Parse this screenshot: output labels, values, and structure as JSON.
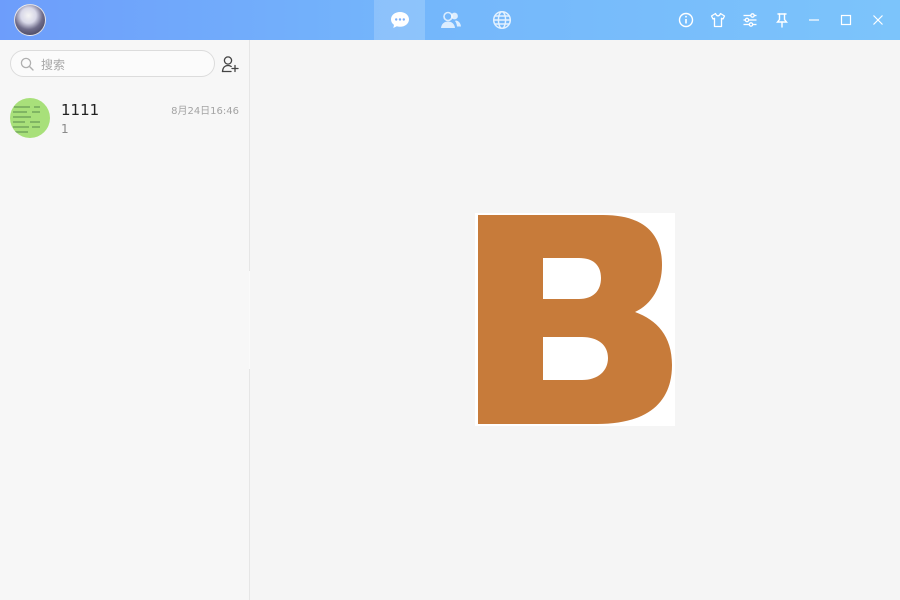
{
  "topbar": {
    "tabs": [
      {
        "name": "chat",
        "icon": "chat-bubble-icon",
        "active": true
      },
      {
        "name": "contacts",
        "icon": "contacts-icon",
        "active": false
      },
      {
        "name": "explore",
        "icon": "globe-icon",
        "active": false
      }
    ],
    "window_actions": [
      "info-icon",
      "theme-shirt-icon",
      "settings-sliders-icon",
      "pin-icon",
      "minimize-icon",
      "maximize-icon",
      "close-icon"
    ]
  },
  "search": {
    "placeholder": "搜索"
  },
  "conversations": [
    {
      "name": "1111",
      "time": "8月24日16:46",
      "preview": "1"
    }
  ],
  "colors": {
    "topbar_start": "#6d9dfb",
    "topbar_end": "#7cc4fb",
    "logo_orange": "#c77b3a",
    "avatar_green": "#a8e07a"
  },
  "main": {
    "logo_icon": "letter-b-logo"
  }
}
